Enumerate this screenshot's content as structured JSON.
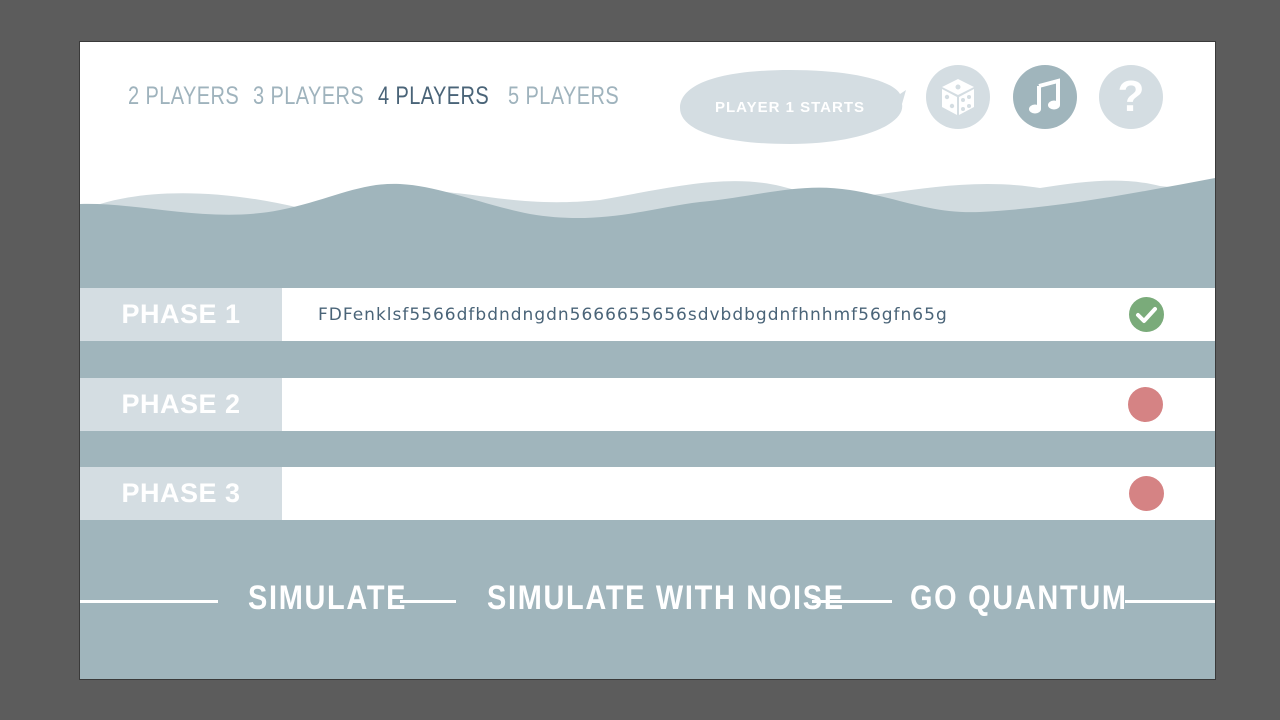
{
  "players": {
    "options": [
      "2 PLAYERS",
      "3 PLAYERS",
      "4 PLAYERS",
      "5 PLAYERS"
    ],
    "selected": "4 PLAYERS"
  },
  "status_bubble": "PLAYER 1 STARTS",
  "icons": {
    "dice": "dice-icon",
    "music": "music-note-icon",
    "help": "question-mark-icon"
  },
  "phases": [
    {
      "label": "PHASE 1",
      "value": "FDFenklsf5566dfbdndngdn5666655656sdvbdbgdnfhnhmf56gfn65g",
      "status": "complete"
    },
    {
      "label": "PHASE 2",
      "value": "",
      "status": "incomplete"
    },
    {
      "label": "PHASE 3",
      "value": "",
      "status": "incomplete"
    }
  ],
  "actions": [
    "SIMULATE",
    "SIMULATE WITH NOISE",
    "GO QUANTUM"
  ],
  "colors": {
    "background_band": "#a0b5bc",
    "phase_label_bg": "#d4dde2",
    "active_tab": "#4a6478",
    "inactive_tab": "#9fb3bd",
    "status_complete": "#7aab7a",
    "status_incomplete": "#d58384"
  }
}
